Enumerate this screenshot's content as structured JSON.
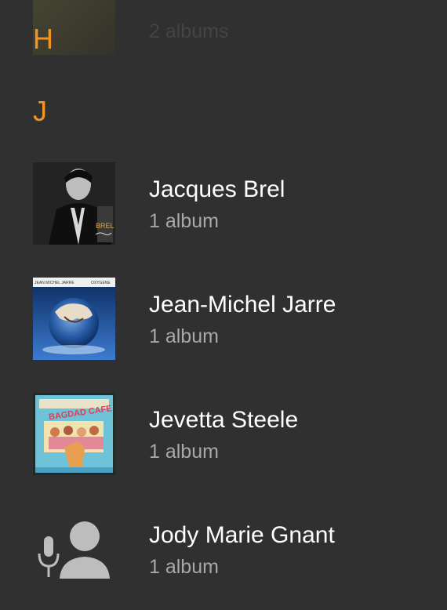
{
  "sections": {
    "h": {
      "letter": "H"
    },
    "j": {
      "letter": "J"
    }
  },
  "faded_artist": {
    "count": "2 albums"
  },
  "artists": [
    {
      "name": "Jacques Brel",
      "count": "1 album",
      "art_text": "BREL"
    },
    {
      "name": "Jean-Michel Jarre",
      "count": "1 album",
      "art_text_left": "JEAN MICHEL JARRE",
      "art_text_right": "OXYGENE"
    },
    {
      "name": "Jevetta Steele",
      "count": "1 album",
      "art_text": "BAGDAD CAFE"
    },
    {
      "name": "Jody Marie Gnant",
      "count": "1 album",
      "art_icon": "artist-placeholder-icon"
    }
  ],
  "colors": {
    "background": "#303030",
    "accent": "#f59321",
    "primary_text": "#ffffff",
    "secondary_text": "#a8a8a8"
  }
}
